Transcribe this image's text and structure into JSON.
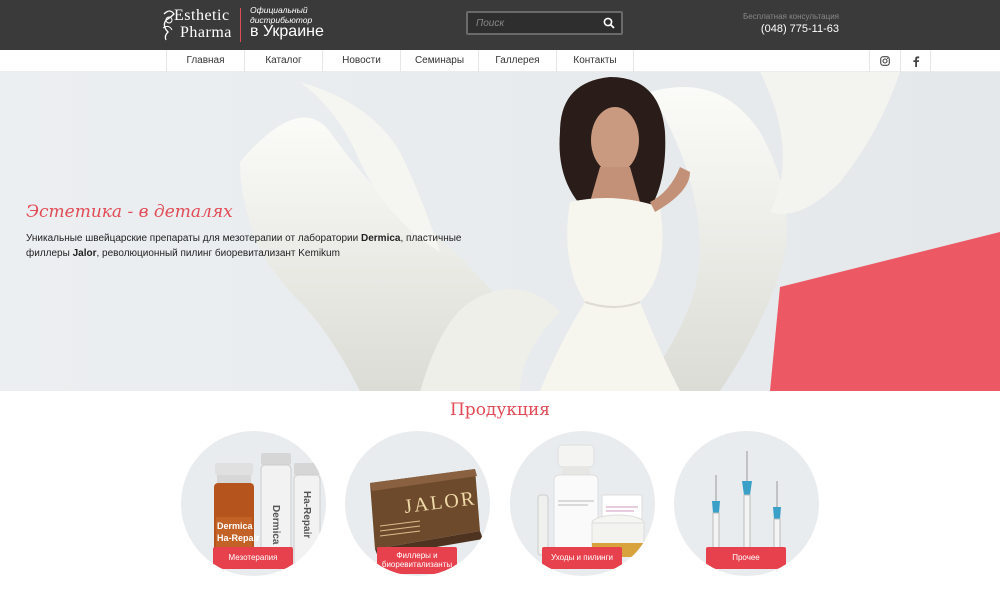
{
  "header": {
    "logo": {
      "line1": "Esthetic",
      "line2": "Pharma"
    },
    "tagline_small": "Официальный дистрибьютор",
    "tagline_big": "в Украине",
    "search_placeholder": "Поиск",
    "consult_label": "Бесплатная консультация",
    "consult_phone": "(048) 775-11-63"
  },
  "nav": {
    "items": [
      {
        "label": "Главная"
      },
      {
        "label": "Каталог"
      },
      {
        "label": "Новости"
      },
      {
        "label": "Семинары"
      },
      {
        "label": "Галлерея"
      },
      {
        "label": "Контакты"
      }
    ],
    "social": [
      "instagram-icon",
      "facebook-icon"
    ]
  },
  "hero": {
    "title": "Эстетика - в деталях",
    "desc_p1": "Уникальные швейцарские препараты для мезотерапии от лаборатории ",
    "desc_b1": "Dermica",
    "desc_p2": ", пластичные филлеры ",
    "desc_b2": "Jalor",
    "desc_p3": ", революционный пилинг биоревитализант Kemikum"
  },
  "products": {
    "title": "Продукция",
    "items": [
      {
        "label": "Мезотерапия",
        "vial_text1": "Dermica",
        "vial_text2": "Ha-Repair"
      },
      {
        "label": "Филлеры и биоревитализанты",
        "box_text": "JALOR"
      },
      {
        "label": "Уходы и пилинги"
      },
      {
        "label": "Прочее"
      }
    ]
  },
  "colors": {
    "accent": "#e14b55",
    "topbar": "#3a3a3a",
    "button": "#e8414e"
  }
}
